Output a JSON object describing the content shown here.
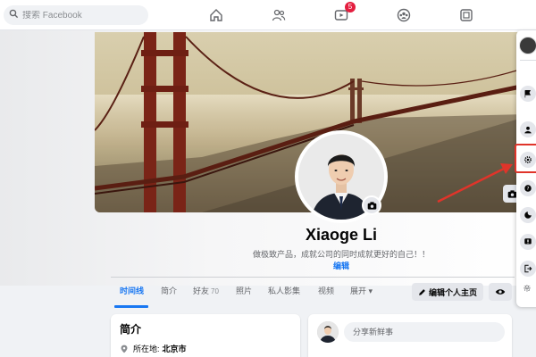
{
  "search": {
    "placeholder": "搜索 Facebook"
  },
  "nav": {
    "icons": [
      "home-icon",
      "friends-icon",
      "watch-icon",
      "groups-icon",
      "gaming-icon"
    ],
    "watch_badge": "5"
  },
  "profile": {
    "name": "Xiaoge Li",
    "bio": "做极致产品，成就公司的同时成就更好的自己！！",
    "edit_bio": "编辑"
  },
  "tabs": [
    {
      "label": "时间线"
    },
    {
      "label": "简介"
    },
    {
      "label": "好友",
      "count": "70"
    },
    {
      "label": "照片"
    },
    {
      "label": "私人影集"
    },
    {
      "label": "视频"
    },
    {
      "label": "展开"
    }
  ],
  "actions": {
    "edit_profile": "编辑个人主页"
  },
  "intro": {
    "title": "简介",
    "location_label": "所在地:",
    "location_value": "北京市"
  },
  "composer": {
    "placeholder": "分享新鲜事"
  },
  "side_panel": {
    "tail_text": "帝"
  },
  "colors": {
    "accent": "#1877f2",
    "highlight": "#e0342a",
    "badge": "#e41e3f"
  }
}
